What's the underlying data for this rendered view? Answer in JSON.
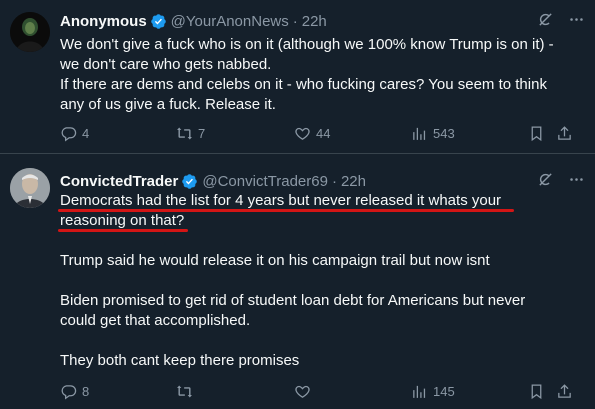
{
  "tweets": [
    {
      "name": "Anonymous",
      "handle": "@YourAnonNews",
      "separator": "·",
      "time": "22h",
      "lines": [
        "We don't give a fuck who is on it (although we 100% know Trump is on it) -",
        "we don't care who gets nabbed.",
        "If there are dems and celebs on it - who fucking cares?  You seem to think",
        "any of us give a fuck.  Release it."
      ],
      "replies": "4",
      "reposts": "7",
      "likes": "44",
      "views": "543"
    },
    {
      "name": "ConvictedTrader",
      "handle": "@ConvictTrader69",
      "separator": "·",
      "time": "22h",
      "highlight_lines": [
        "Democrats had the list for 4 years but never released it whats your",
        "reasoning on that?"
      ],
      "para2": "Trump said he would release it on his campaign trail but now isnt",
      "para3_lines": [
        "Biden promised to get rid of student loan debt for Americans but never",
        "could get that accomplished."
      ],
      "para4": "They both cant keep there promises",
      "replies": "8",
      "reposts": "",
      "likes": "",
      "views": "145"
    }
  ],
  "colors": {
    "background": "#15202b",
    "text": "#f7f9f9",
    "secondary": "#8b98a5",
    "verified": "#1d9bf0",
    "annotation": "#d31515"
  },
  "icons": [
    "verified-icon",
    "grok-icon",
    "more-icon",
    "reply-icon",
    "repost-icon",
    "like-icon",
    "views-icon",
    "bookmark-icon",
    "share-icon"
  ]
}
